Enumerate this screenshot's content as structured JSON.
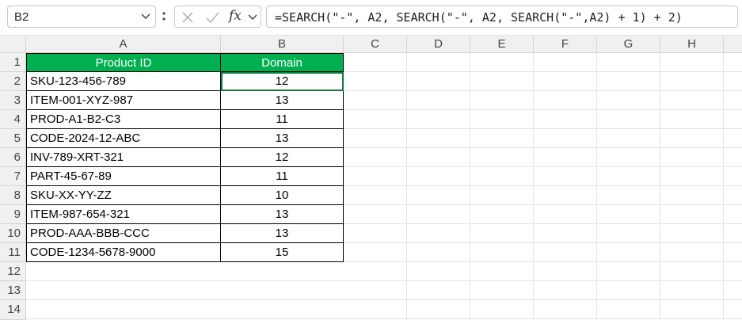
{
  "formula_bar": {
    "name_box": "B2",
    "fx_label": "fx",
    "formula": "=SEARCH(\"-\", A2, SEARCH(\"-\", A2, SEARCH(\"-\",A2) + 1) + 2)"
  },
  "columns": [
    "A",
    "B",
    "C",
    "D",
    "E",
    "F",
    "G",
    "H"
  ],
  "rows": [
    "1",
    "2",
    "3",
    "4",
    "5",
    "6",
    "7",
    "8",
    "9",
    "10",
    "11",
    "12",
    "13",
    "14"
  ],
  "table": {
    "headers": [
      "Product ID",
      "Domain"
    ],
    "rows": [
      [
        "SKU-123-456-789",
        "12"
      ],
      [
        "ITEM-001-XYZ-987",
        "13"
      ],
      [
        "PROD-A1-B2-C3",
        "11"
      ],
      [
        "CODE-2024-12-ABC",
        "13"
      ],
      [
        "INV-789-XRT-321",
        "12"
      ],
      [
        "PART-45-67-89",
        "11"
      ],
      [
        "SKU-XX-YY-ZZ",
        "10"
      ],
      [
        "ITEM-987-654-321",
        "13"
      ],
      [
        "PROD-AAA-BBB-CCC",
        "13"
      ],
      [
        "CODE-1234-5678-9000",
        "15"
      ]
    ]
  },
  "colors": {
    "header_fill": "#00b050",
    "header_text": "#ffffff"
  }
}
